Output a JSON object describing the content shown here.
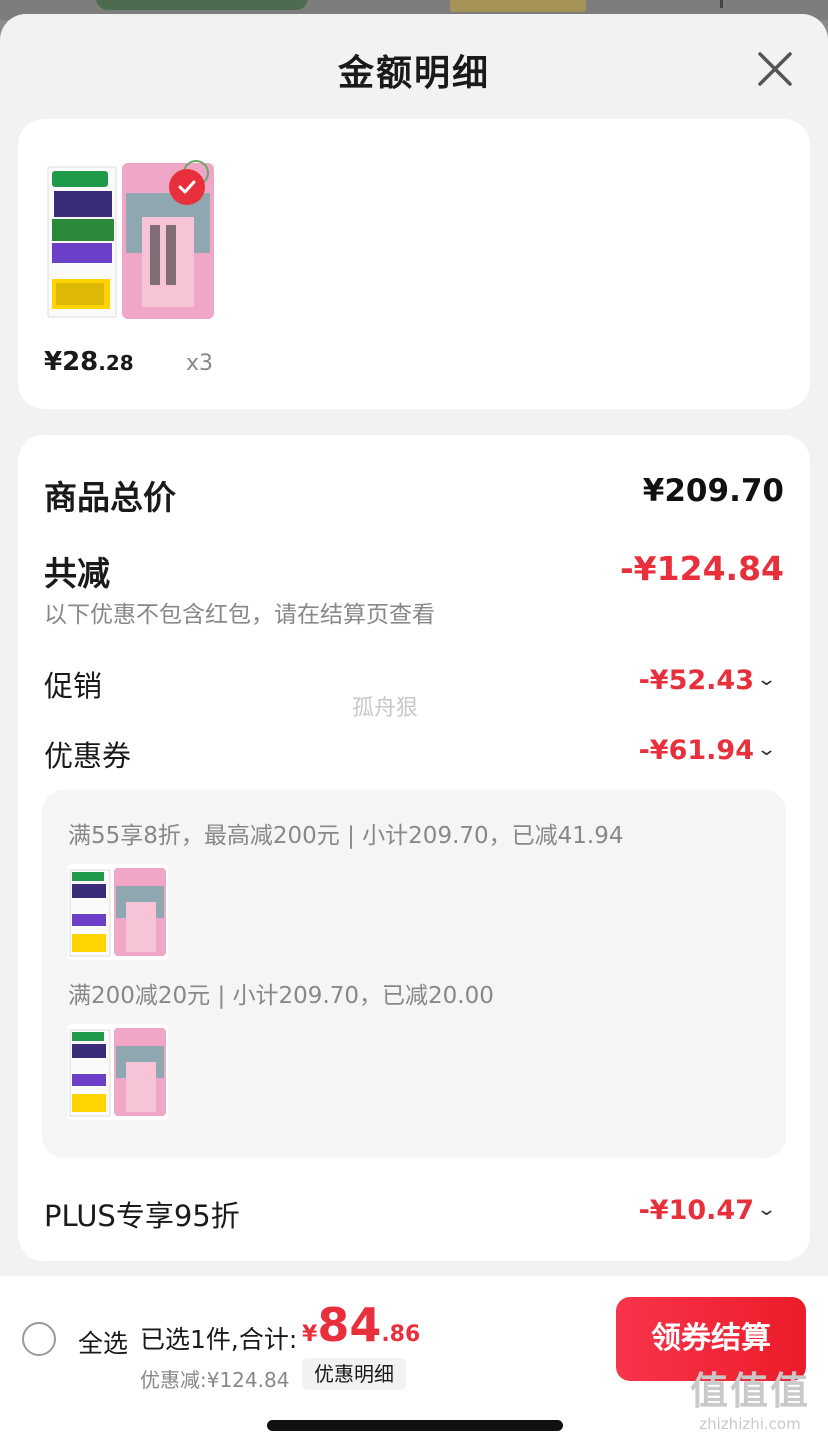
{
  "sheet": {
    "title": "金额明细"
  },
  "product": {
    "price_int": "¥28",
    "price_dec": ".28",
    "qty": "x3",
    "image_name": "rice-package-image"
  },
  "detail": {
    "total_label": "商品总价",
    "total_value": "¥209.70",
    "reduce_label": "共减",
    "reduce_value": "-¥124.84",
    "reduce_note": "以下优惠不包含红包，请在结算页查看",
    "promo_label": "促销",
    "promo_value": "-¥52.43",
    "coupon_label": "优惠券",
    "coupon_value": "-¥61.94",
    "plus_label": "PLUS专享95折",
    "plus_value": "-¥10.47"
  },
  "coupons": [
    {
      "text": "满55享8折，最高减200元 | 小计209.70，已减41.94"
    },
    {
      "text": "满200减20元 | 小计209.70，已减20.00"
    }
  ],
  "watermark": "孤舟狠",
  "bottom": {
    "select_all": "全选",
    "selected_text": "已选1件,合计:",
    "total_cur": "¥",
    "total_int": "84",
    "total_dec": ".86",
    "discount_text": "优惠减:¥124.84",
    "detail_link": "优惠明细",
    "checkout": "领券结算"
  },
  "site": {
    "logo": "值值值",
    "domain": "zhizhizhi.com"
  },
  "colors": {
    "accent_red": "#e8303c",
    "gray_text": "#888888"
  }
}
